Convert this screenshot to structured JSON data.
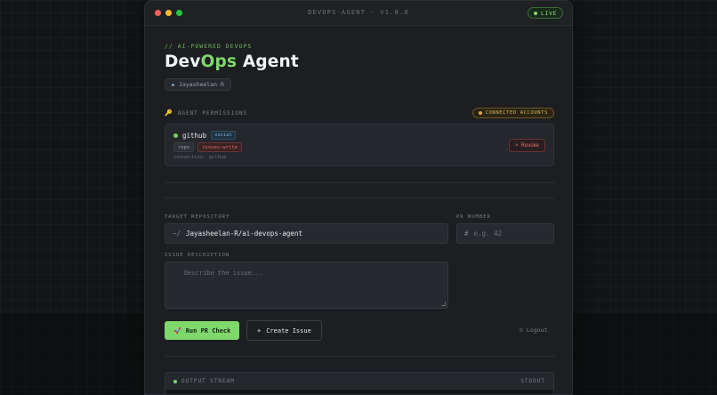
{
  "window": {
    "title": "DEVOPS-AGENT · V1.0.0",
    "status_badge": "LIVE",
    "traffic_lights": [
      "#ff5f57",
      "#febc2e",
      "#28c840"
    ]
  },
  "header": {
    "kicker": "// AI-POWERED DEVOPS",
    "title_prefix": "Dev",
    "title_accent": "Ops",
    "title_suffix": " Agent",
    "user": "Jayasheelan R"
  },
  "permissions": {
    "title": "AGENT PERMISSIONS",
    "connected_badge": "CONNECTED ACCOUNTS",
    "account": {
      "name": "github",
      "tag": "social",
      "scopes": [
        "repo",
        "issues:write"
      ],
      "connection": "connection: github",
      "revoke_label": "Revoke"
    }
  },
  "form": {
    "repo_label": "TARGET REPOSITORY",
    "repo_prefix": "~/",
    "repo_value": "Jayasheelan-R/ai-devops-agent",
    "pr_label": "PR NUMBER",
    "pr_prefix": "#",
    "pr_placeholder": "e.g. 42",
    "issue_label": "ISSUE DESCRIPTION",
    "issue_placeholder": "Describe the issue..."
  },
  "actions": {
    "run_pr_label": "Run PR Check",
    "create_issue_label": "Create Issue",
    "logout_label": "Logout"
  },
  "output": {
    "title": "OUTPUT STREAM",
    "stream": "STDOUT"
  },
  "colors": {
    "accent": "#7fd86c",
    "danger": "#e0706a",
    "warning": "#d9b650",
    "background": "#1c1e21"
  }
}
